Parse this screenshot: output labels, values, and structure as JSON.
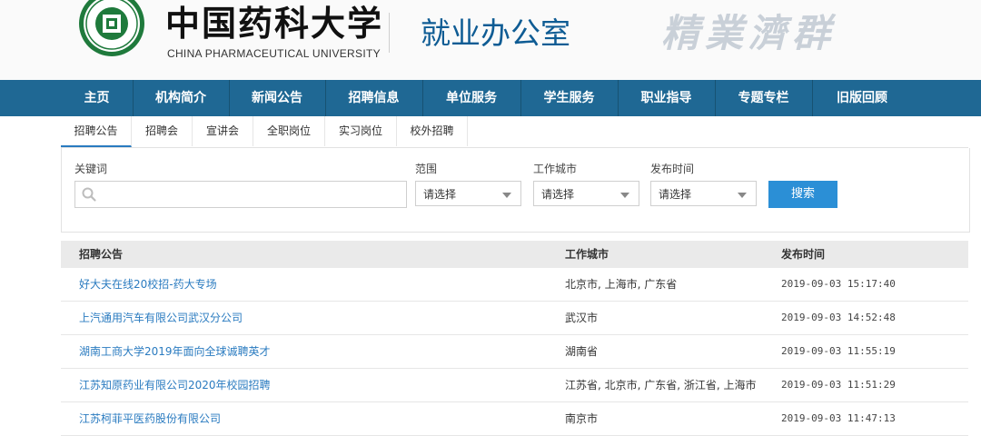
{
  "header": {
    "logo_cn": "中国药科大学",
    "logo_en": "CHINA PHARMACEUTICAL UNIVERSITY",
    "office_title": "就业办公室",
    "motto": "精業濟群"
  },
  "nav": {
    "items": [
      {
        "label": "主页"
      },
      {
        "label": "机构简介"
      },
      {
        "label": "新闻公告"
      },
      {
        "label": "招聘信息"
      },
      {
        "label": "单位服务"
      },
      {
        "label": "学生服务"
      },
      {
        "label": "职业指导"
      },
      {
        "label": "专题专栏"
      },
      {
        "label": "旧版回顾"
      }
    ]
  },
  "subtabs": {
    "items": [
      {
        "label": "招聘公告"
      },
      {
        "label": "招聘会"
      },
      {
        "label": "宣讲会"
      },
      {
        "label": "全职岗位"
      },
      {
        "label": "实习岗位"
      },
      {
        "label": "校外招聘"
      }
    ]
  },
  "filters": {
    "keyword_label": "关键词",
    "keyword_value": "",
    "scope_label": "范围",
    "scope_value": "请选择",
    "city_label": "工作城市",
    "city_value": "请选择",
    "date_label": "发布时间",
    "date_value": "请选择",
    "search_button": "搜索"
  },
  "table": {
    "columns": [
      "招聘公告",
      "工作城市",
      "发布时间"
    ],
    "rows": [
      {
        "title": "好大夫在线20校招-药大专场",
        "city": "北京市, 上海市, 广东省",
        "time": "2019-09-03 15:17:40"
      },
      {
        "title": "上汽通用汽车有限公司武汉分公司",
        "city": "武汉市",
        "time": "2019-09-03 14:52:48"
      },
      {
        "title": "湖南工商大学2019年面向全球诚聘英才",
        "city": "湖南省",
        "time": "2019-09-03 11:55:19"
      },
      {
        "title": "江苏知原药业有限公司2020年校园招聘",
        "city": "江苏省, 北京市, 广东省, 浙江省, 上海市",
        "time": "2019-09-03 11:51:29"
      },
      {
        "title": "江苏柯菲平医药股份有限公司",
        "city": "南京市",
        "time": "2019-09-03 11:47:13"
      }
    ]
  },
  "colors": {
    "nav_bg": "#1f6894",
    "link": "#2a7bc0",
    "button": "#2b8fd6",
    "office_title": "#0f5c94"
  }
}
